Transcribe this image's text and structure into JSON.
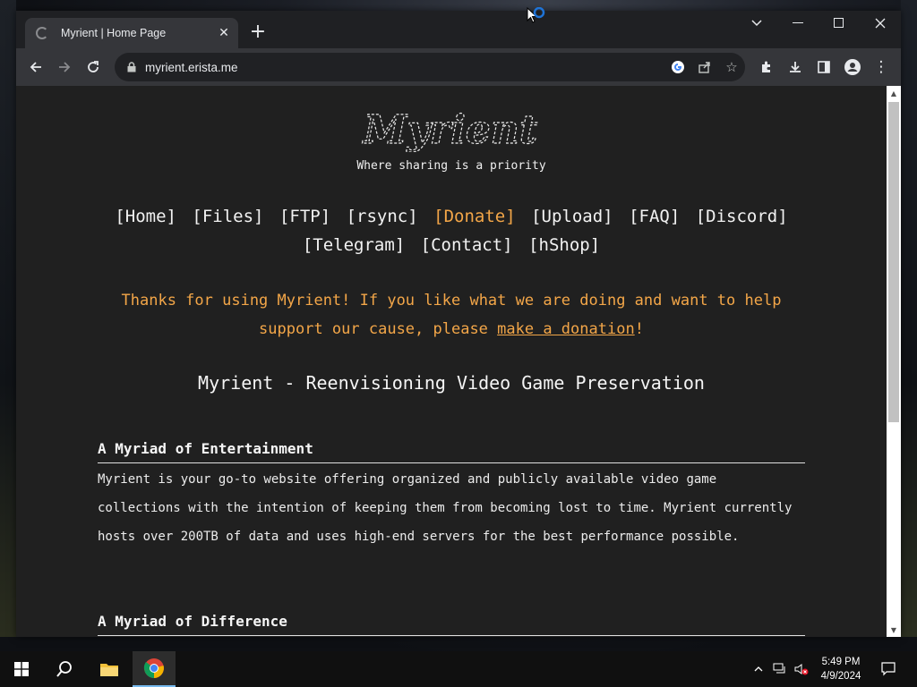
{
  "browser": {
    "tab_title": "Myrient | Home Page",
    "url": "myrient.erista.me"
  },
  "site": {
    "logo_text": "Myrient",
    "tagline": "Where sharing is a priority",
    "nav": [
      "[Home]",
      "[Files]",
      "[FTP]",
      "[rsync]",
      "[Donate]",
      "[Upload]",
      "[FAQ]",
      "[Discord]",
      "[Telegram]",
      "[Contact]",
      "[hShop]"
    ],
    "thanks_pre": "Thanks for using Myrient! If you like what we are doing and want to help support our cause, please ",
    "thanks_link": "make a donation",
    "thanks_post": "!",
    "headline": "Myrient - Reenvisioning Video Game Preservation",
    "sections": [
      {
        "title": "A Myriad of Entertainment",
        "body": "Myrient is your go-to website offering organized and publicly available video game collections with the intention of keeping them from becoming lost to time. Myrient currently hosts over 200TB of data and uses high-end servers for the best performance possible."
      },
      {
        "title": "A Myriad of Difference",
        "body": ""
      }
    ],
    "accent_color": "#f3a648"
  },
  "taskbar": {
    "time": "5:49 PM",
    "date": "4/9/2024"
  }
}
